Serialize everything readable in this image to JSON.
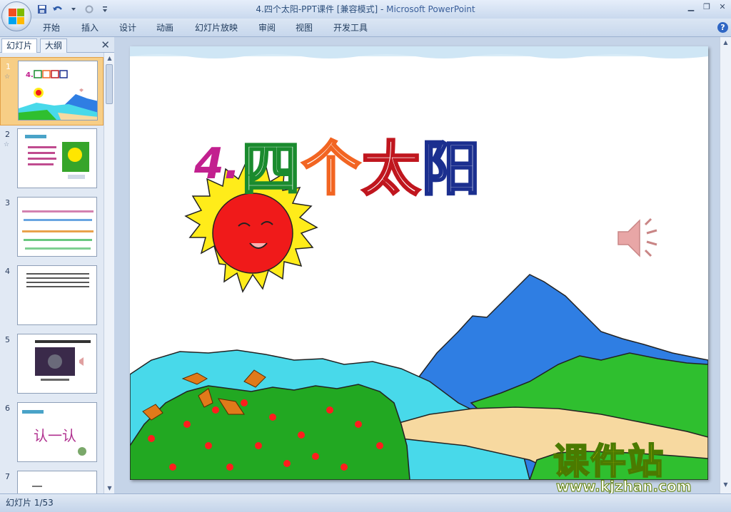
{
  "window": {
    "title": "4.四个太阳-PPT课件 [兼容模式]",
    "separator": " - ",
    "app_name": "Microsoft PowerPoint",
    "minimize": "▁",
    "restore": "❐",
    "close": "✕"
  },
  "ribbon": {
    "tabs": [
      "开始",
      "插入",
      "设计",
      "动画",
      "幻灯片放映",
      "审阅",
      "视图",
      "开发工具"
    ],
    "help": "?"
  },
  "panel": {
    "tabs": [
      "幻灯片",
      "大纲"
    ],
    "close": "✕",
    "thumbnails": [
      {
        "number": "1",
        "selected": true
      },
      {
        "number": "2",
        "selected": false
      },
      {
        "number": "3",
        "selected": false
      },
      {
        "number": "4",
        "selected": false
      },
      {
        "number": "5",
        "selected": false
      },
      {
        "number": "6",
        "selected": false
      },
      {
        "number": "7",
        "selected": false
      }
    ],
    "thumb6_text": "认一认"
  },
  "slide": {
    "title_number": "4.",
    "title_chars": [
      "四",
      "个",
      "太",
      "阳"
    ],
    "title_colors": [
      "#1a8b2e",
      "#f26522",
      "#c0161e",
      "#1b2f8f"
    ]
  },
  "status": {
    "text": "幻灯片 1/53"
  },
  "watermark": {
    "chinese": "课件站",
    "url": "www.kjzhan.com"
  },
  "colors": {
    "sky_band": "#d9ecf7",
    "sun": "#ffec1a",
    "sun_face": "#f01a1a",
    "mountain_blue": "#2f7ee3",
    "mountain_light": "#48d9ea",
    "grass": "#2fbf2f",
    "road": "#f7d9a0"
  }
}
